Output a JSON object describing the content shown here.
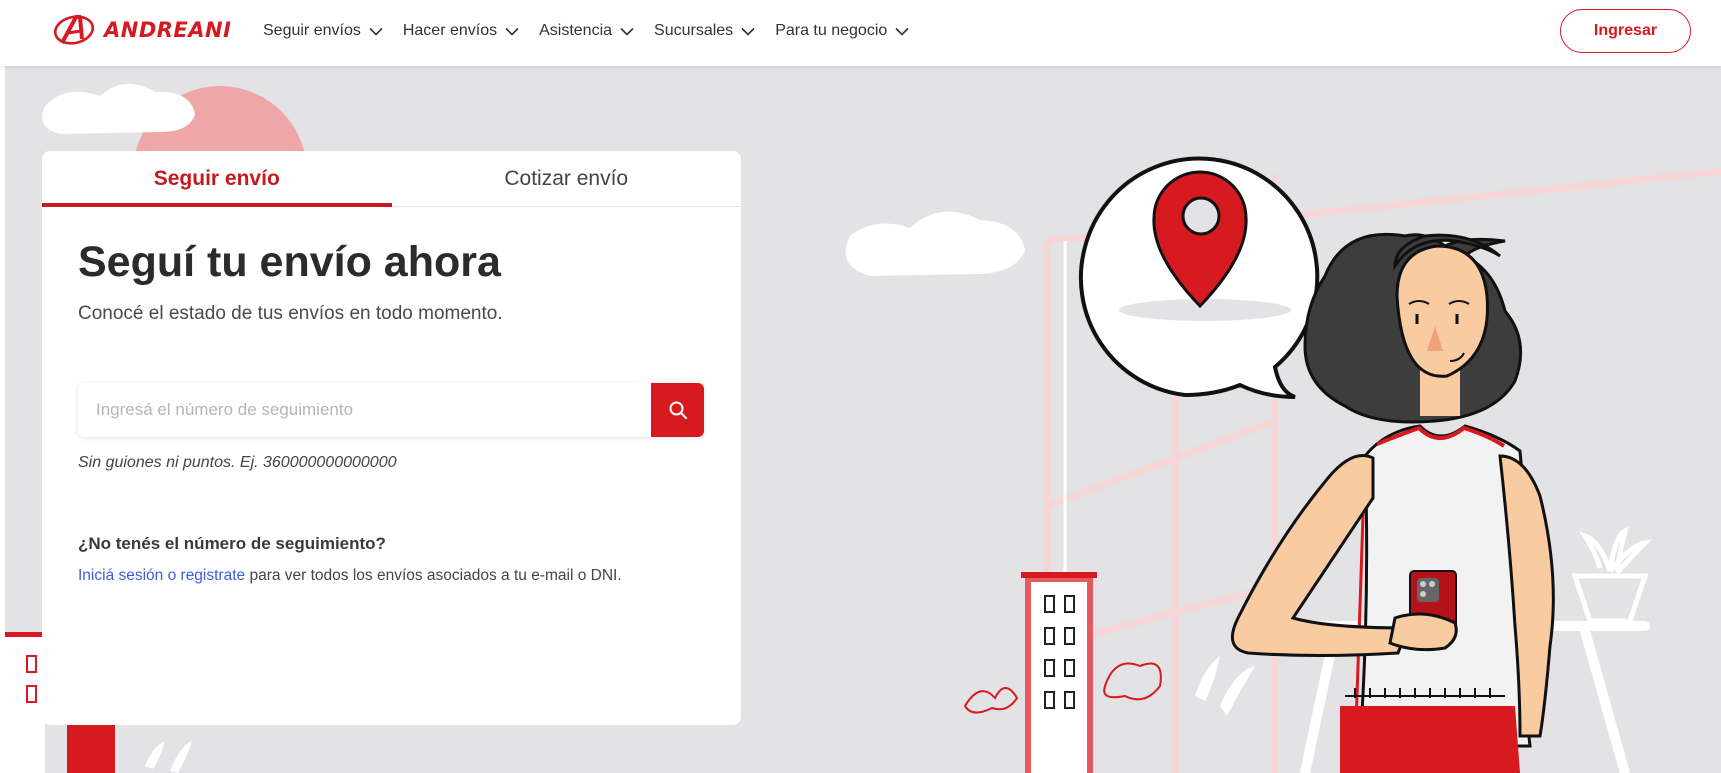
{
  "brand": {
    "name": "ANDREANI",
    "color": "#d71920"
  },
  "nav": {
    "items": [
      {
        "label": "Seguir envíos"
      },
      {
        "label": "Hacer envíos"
      },
      {
        "label": "Asistencia"
      },
      {
        "label": "Sucursales"
      },
      {
        "label": "Para tu negocio"
      }
    ],
    "login_label": "Ingresar"
  },
  "card": {
    "tabs": [
      {
        "label": "Seguir envío",
        "active": true
      },
      {
        "label": "Cotizar envío",
        "active": false
      }
    ],
    "title": "Seguí tu envío ahora",
    "subtitle": "Conocé el estado de tus envíos en todo momento.",
    "search": {
      "placeholder": "Ingresá el número de seguimiento",
      "value": ""
    },
    "hint": "Sin guiones ni puntos. Ej. 360000000000000",
    "question": "¿No tenés el número de seguimiento?",
    "answer_link": "Iniciá sesión o registrate",
    "answer_rest": " para ver todos los envíos asociados a tu e-mail o DNI."
  },
  "icons": [
    "andreani-logo-icon",
    "chevron-down-icon",
    "search-icon",
    "location-pin-icon"
  ]
}
